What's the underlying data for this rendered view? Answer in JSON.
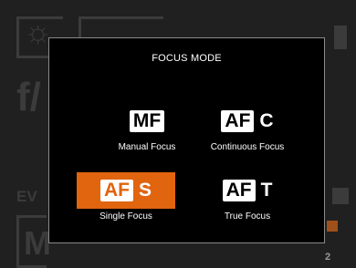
{
  "background": {
    "ev_label": "EV",
    "aperture_label": "f/",
    "mode_label": "M",
    "counter_label": "2"
  },
  "dialog": {
    "title": "FOCUS MODE",
    "options": [
      {
        "badge": "MF",
        "suffix": "",
        "label": "Manual Focus",
        "selected": false
      },
      {
        "badge": "AF",
        "suffix": "C",
        "label": "Continuous Focus",
        "selected": false
      },
      {
        "badge": "AF",
        "suffix": "S",
        "label": "Single Focus",
        "selected": true
      },
      {
        "badge": "AF",
        "suffix": "T",
        "label": "True Focus",
        "selected": false
      }
    ]
  },
  "colors": {
    "accent": "#e1640f",
    "dialog_bg": "#000000",
    "dim_text": "#3b3b3b"
  }
}
